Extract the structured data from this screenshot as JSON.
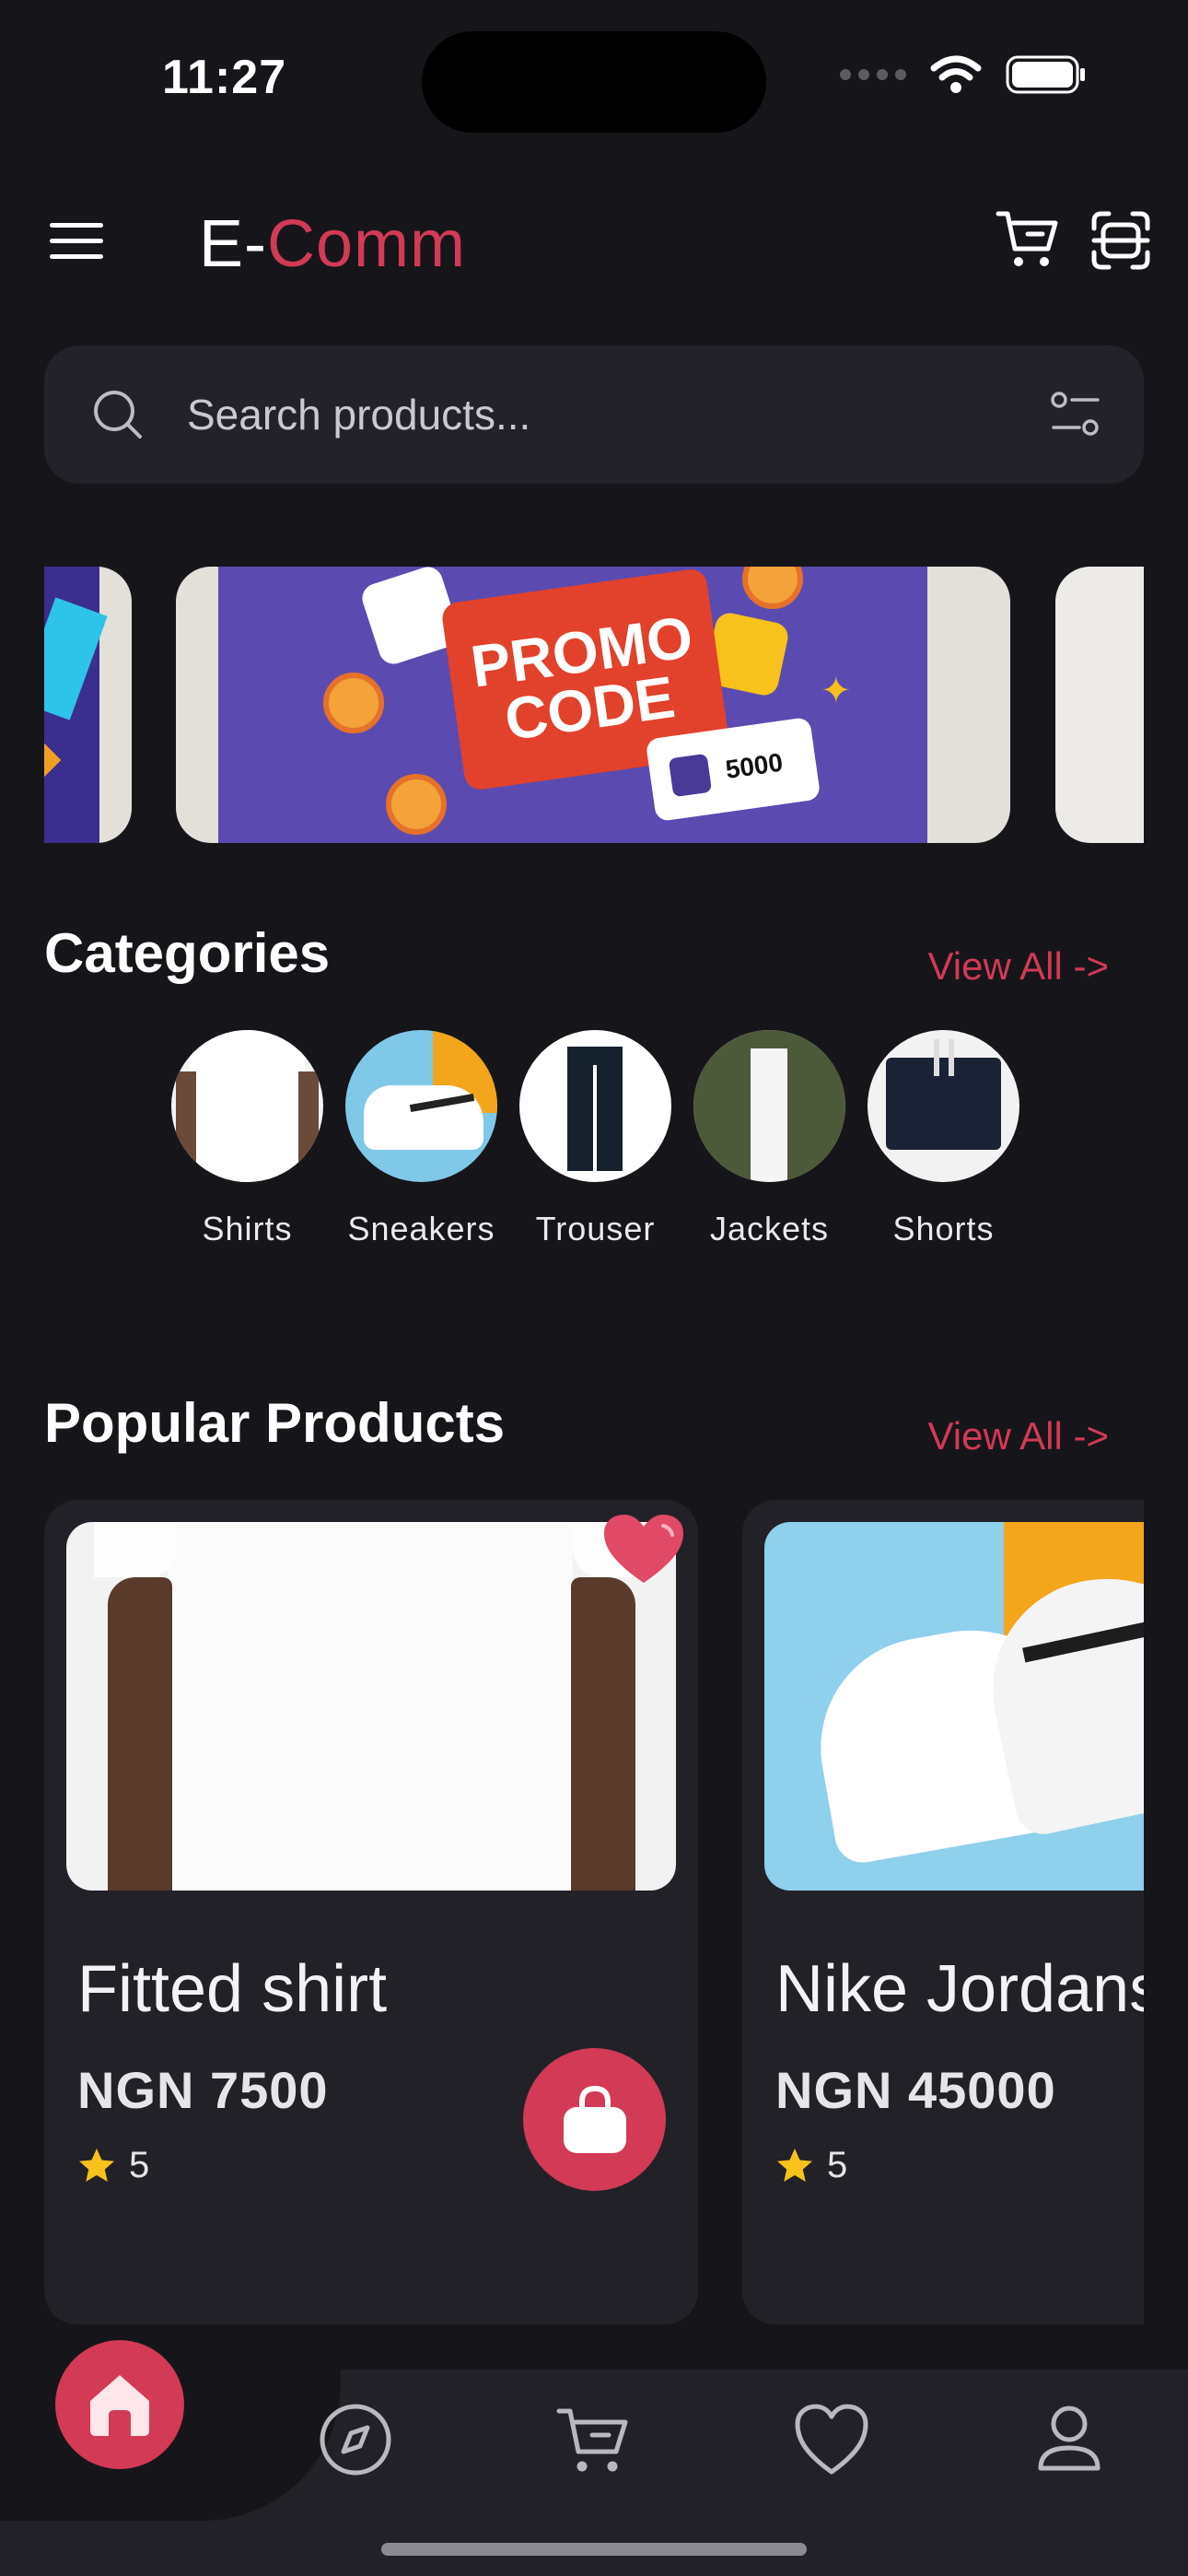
{
  "status_bar": {
    "time": "11:27"
  },
  "header": {
    "logo_prefix": "E-",
    "logo_accent": "Comm",
    "accent_color": "#d23a55"
  },
  "search": {
    "placeholder": "Search products..."
  },
  "banners": {
    "promo_line1": "PROMO",
    "promo_line2": "CODE",
    "voucher_value": "5000"
  },
  "categories": {
    "title": "Categories",
    "view_all": "View All ->",
    "items": [
      {
        "label": "Shirts"
      },
      {
        "label": "Sneakers"
      },
      {
        "label": "Trouser"
      },
      {
        "label": "Jackets"
      },
      {
        "label": "Shorts"
      }
    ]
  },
  "popular": {
    "title": "Popular Products",
    "view_all": "View All ->",
    "products": [
      {
        "name": "Fitted shirt",
        "price": "NGN 7500",
        "rating": "5"
      },
      {
        "name": "Nike Jordans",
        "price": "NGN 45000",
        "rating": "5"
      }
    ]
  },
  "nav": {
    "items": [
      {
        "icon": "home-icon"
      },
      {
        "icon": "compass-icon"
      },
      {
        "icon": "cart-icon"
      },
      {
        "icon": "heart-icon"
      },
      {
        "icon": "profile-icon"
      }
    ]
  }
}
